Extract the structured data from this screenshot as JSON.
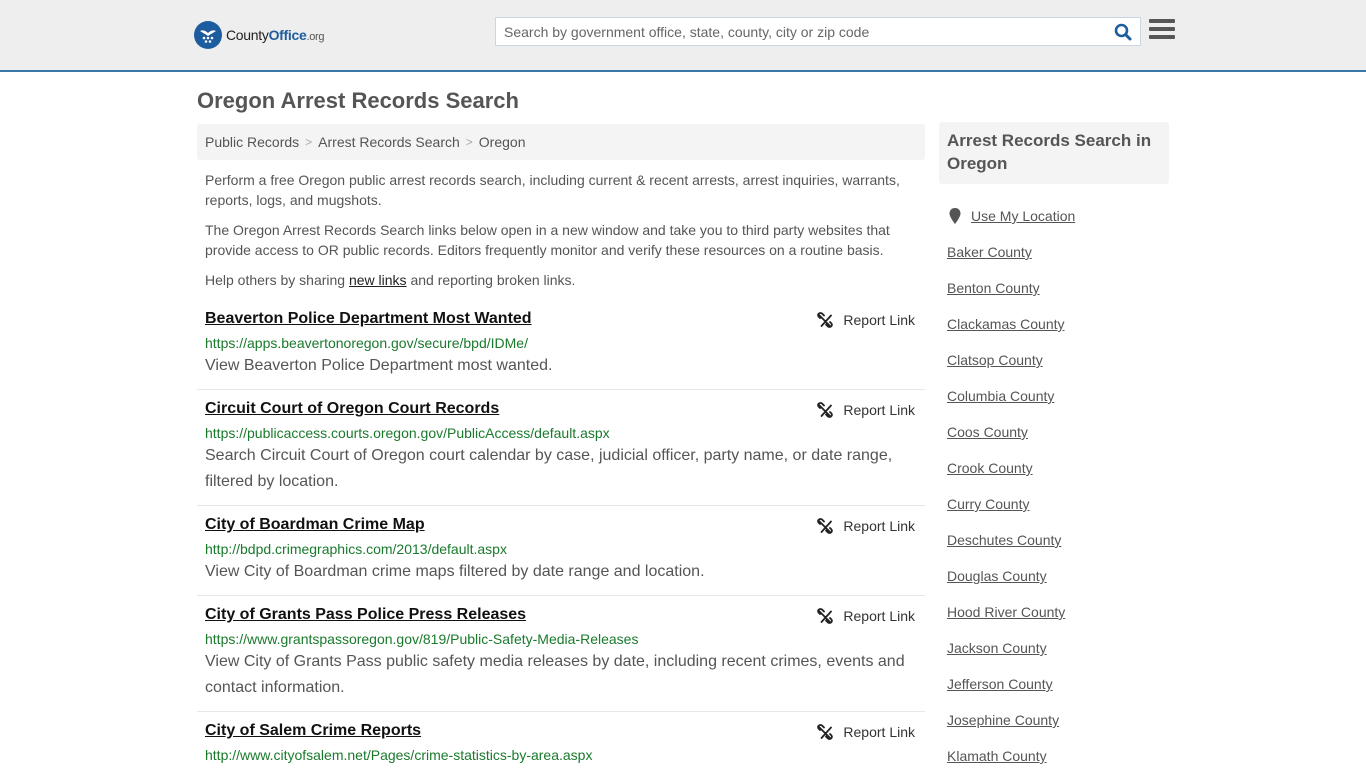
{
  "header": {
    "logo": {
      "name": "County",
      "highlight": "Office",
      "tld": ".org"
    },
    "search": {
      "placeholder": "Search by government office, state, county, city or zip code",
      "value": ""
    },
    "brand_color": "#1d5c9e"
  },
  "page": {
    "title": "Oregon Arrest Records Search",
    "breadcrumb": [
      "Public Records",
      "Arrest Records Search",
      "Oregon"
    ],
    "intro": {
      "p1": "Perform a free Oregon public arrest records search, including current & recent arrests, arrest inquiries, warrants, reports, logs, and mugshots.",
      "p2": "The Oregon Arrest Records Search links below open in a new window and take you to third party websites that provide access to OR public records. Editors frequently monitor and verify these resources on a routine basis.",
      "p3_before": "Help others by sharing ",
      "p3_link": "new links",
      "p3_after": " and reporting broken links."
    }
  },
  "results": [
    {
      "title": "Beaverton Police Department Most Wanted",
      "url": "https://apps.beavertonoregon.gov/secure/bpd/IDMe/",
      "desc": "View Beaverton Police Department most wanted.",
      "report": "Report Link"
    },
    {
      "title": "Circuit Court of Oregon Court Records",
      "url": "https://publicaccess.courts.oregon.gov/PublicAccess/default.aspx",
      "desc": "Search Circuit Court of Oregon court calendar by case, judicial officer, party name, or date range, filtered by location.",
      "report": "Report Link"
    },
    {
      "title": "City of Boardman Crime Map",
      "url": "http://bdpd.crimegraphics.com/2013/default.aspx",
      "desc": "View City of Boardman crime maps filtered by date range and location.",
      "report": "Report Link"
    },
    {
      "title": "City of Grants Pass Police Press Releases",
      "url": "https://www.grantspassoregon.gov/819/Public-Safety-Media-Releases",
      "desc": "View City of Grants Pass public safety media releases by date, including recent crimes, events and contact information.",
      "report": "Report Link"
    },
    {
      "title": "City of Salem Crime Reports",
      "url": "http://www.cityofsalem.net/Pages/crime-statistics-by-area.aspx",
      "desc": "",
      "report": "Report Link"
    }
  ],
  "sidebar": {
    "heading": "Arrest Records Search in Oregon",
    "use_location": "Use My Location",
    "counties": [
      "Baker County",
      "Benton County",
      "Clackamas County",
      "Clatsop County",
      "Columbia County",
      "Coos County",
      "Crook County",
      "Curry County",
      "Deschutes County",
      "Douglas County",
      "Hood River County",
      "Jackson County",
      "Jefferson County",
      "Josephine County",
      "Klamath County"
    ]
  }
}
